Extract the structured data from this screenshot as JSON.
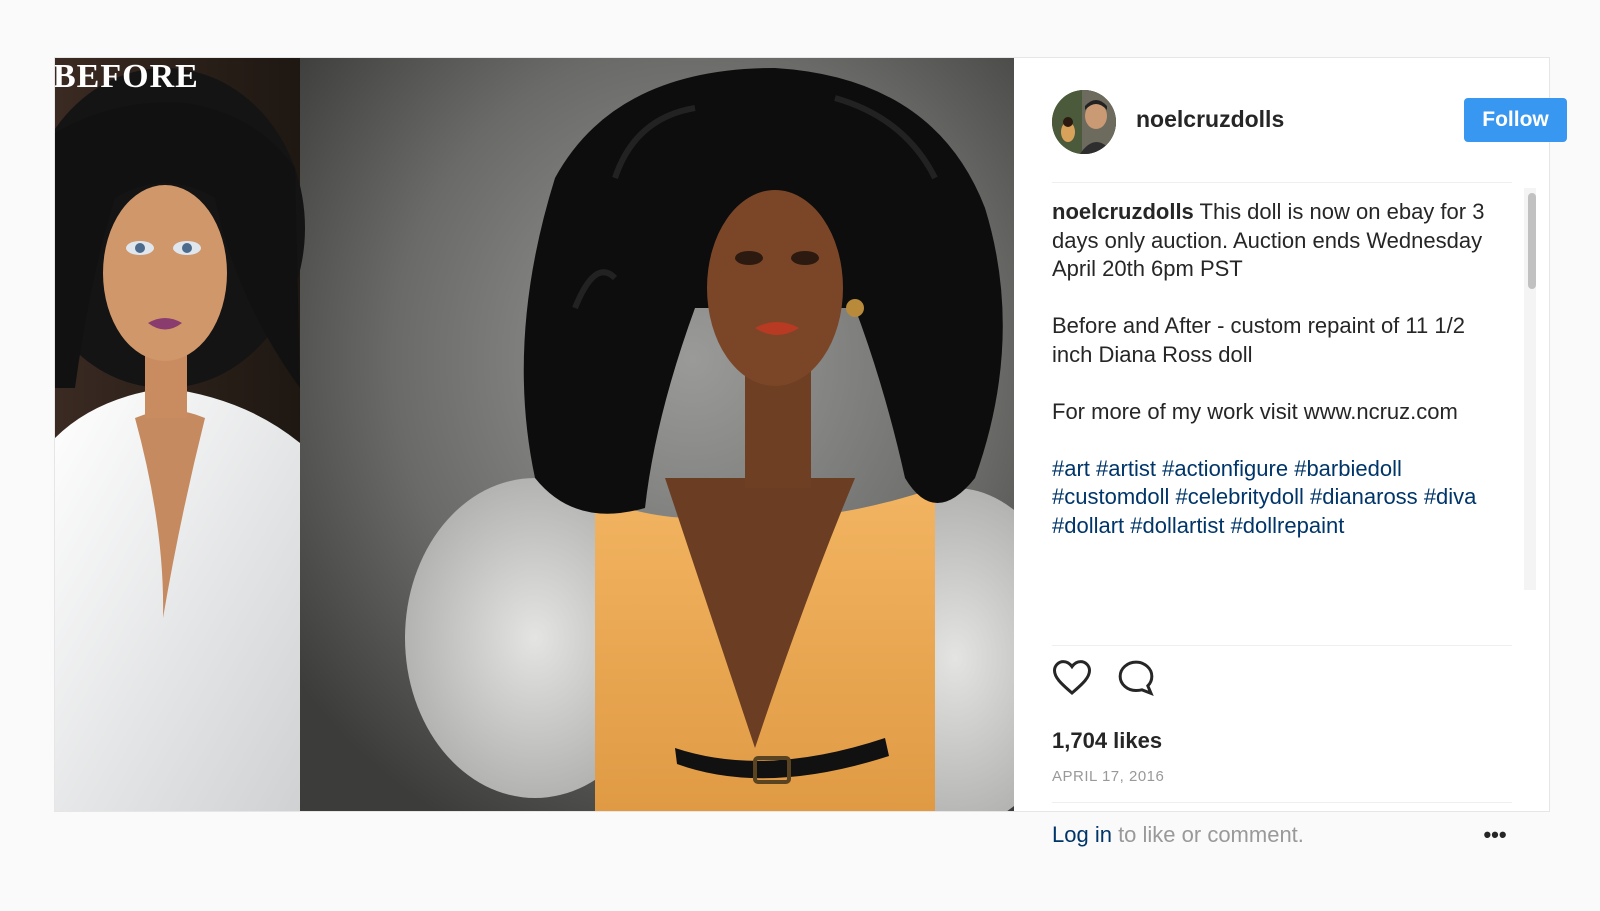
{
  "post": {
    "before_label": "BEFORE",
    "username": "noelcruzdolls",
    "follow_label": "Follow",
    "caption": {
      "user": "noelcruzdolls",
      "line1_rest": " This doll is now on ebay for 3 days only auction. Auction ends Wednesday April 20th 6pm PST",
      "paragraph2": "Before and After - custom repaint of 11 1/2 inch Diana Ross doll",
      "paragraph3": "For more of my work visit www.ncruz.com",
      "hashtags": [
        "#art",
        "#artist",
        "#actionfigure",
        "#barbiedoll",
        "#customdoll",
        "#celebritydoll",
        "#dianaross",
        "#diva",
        "#dollart",
        "#dollartist",
        "#dollrepaint"
      ]
    },
    "likes": "1,704 likes",
    "date": "APRIL 17, 2016",
    "comment_prompt": {
      "login": "Log in",
      "rest": " to like or comment."
    },
    "more_label": "•••"
  },
  "colors": {
    "accent": "#3897f0",
    "link": "#003569",
    "muted": "#999999"
  },
  "icons": [
    "heart-icon",
    "comment-icon",
    "more-options-icon"
  ]
}
